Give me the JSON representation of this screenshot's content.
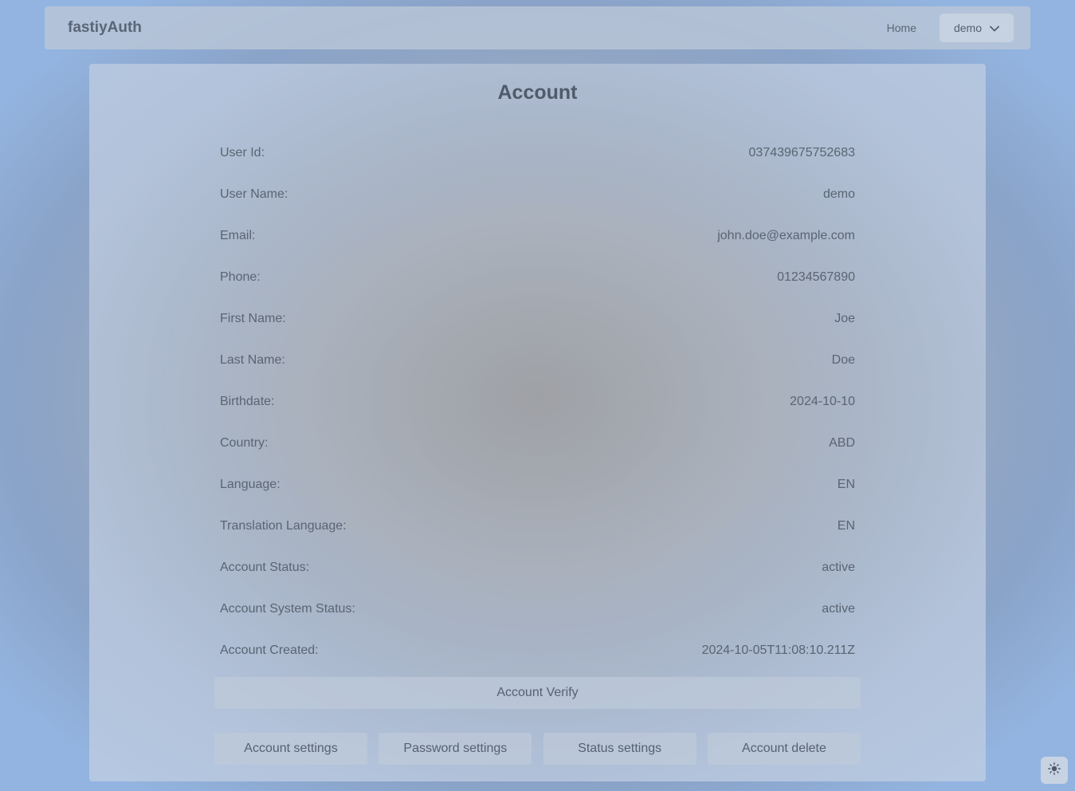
{
  "navbar": {
    "brand": "fastiyAuth",
    "home_label": "Home",
    "user_menu_label": "demo"
  },
  "account": {
    "title": "Account",
    "fields": [
      {
        "label": "User Id:",
        "value": "037439675752683"
      },
      {
        "label": "User Name:",
        "value": "demo"
      },
      {
        "label": "Email:",
        "value": "john.doe@example.com"
      },
      {
        "label": "Phone:",
        "value": "01234567890"
      },
      {
        "label": "First Name:",
        "value": "Joe"
      },
      {
        "label": "Last Name:",
        "value": "Doe"
      },
      {
        "label": "Birthdate:",
        "value": "2024-10-10"
      },
      {
        "label": "Country:",
        "value": "ABD"
      },
      {
        "label": "Language:",
        "value": "EN"
      },
      {
        "label": "Translation Language:",
        "value": "EN"
      },
      {
        "label": "Account Status:",
        "value": "active"
      },
      {
        "label": "Account System Status:",
        "value": "active"
      },
      {
        "label": "Account Created:",
        "value": "2024-10-05T11:08:10.211Z"
      }
    ],
    "verify_label": "Account Verify",
    "actions": {
      "account_settings": "Account settings",
      "password_settings": "Password settings",
      "status_settings": "Status settings",
      "account_delete": "Account delete"
    }
  },
  "icons": {
    "user_menu": "chevron-down-icon",
    "theme_toggle": "sun-icon"
  },
  "colors": {
    "text": "#5a6473",
    "title": "#4f5b6c"
  }
}
